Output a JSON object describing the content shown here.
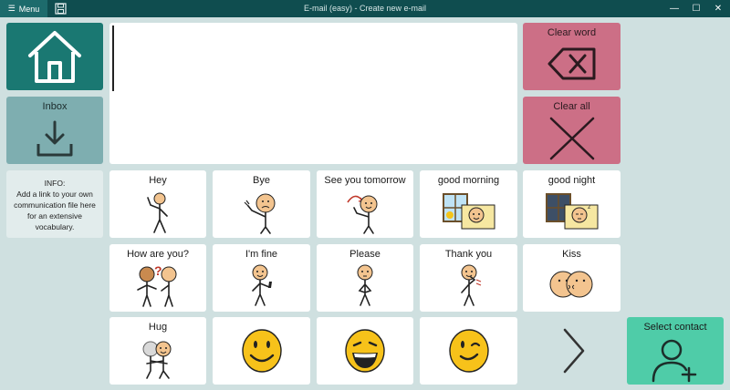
{
  "titlebar": {
    "menu_label": "Menu",
    "title": "E-mail (easy) - Create new e-mail",
    "minimize": "—",
    "maximize": "☐",
    "close": "✕"
  },
  "nav": {
    "home_icon": "home-icon",
    "inbox_label": "Inbox",
    "info_text": "INFO:\nAdd a link to your own\ncommunication file here\nfor an extensive\nvocabulary."
  },
  "editor": {
    "value": ""
  },
  "actions": {
    "clear_word": "Clear word",
    "clear_all": "Clear all",
    "select_contact": "Select contact"
  },
  "phrases": [
    {
      "label": "Hey"
    },
    {
      "label": "Bye"
    },
    {
      "label": "See you tomorrow"
    },
    {
      "label": "good morning"
    },
    {
      "label": "good night"
    },
    {
      "label": "How are you?"
    },
    {
      "label": "I'm fine"
    },
    {
      "label": "Please"
    },
    {
      "label": "Thank you"
    },
    {
      "label": "Kiss"
    },
    {
      "label": "Hug"
    }
  ],
  "emojis": [
    "smile-emoji",
    "laugh-emoji",
    "wink-emoji"
  ],
  "colors": {
    "titlebar": "#0f4d4f",
    "home": "#1a7872",
    "inbox": "#7eaeb0",
    "clear": "#cc6f86",
    "contact": "#4fcca8",
    "background": "#cfe0e0"
  }
}
